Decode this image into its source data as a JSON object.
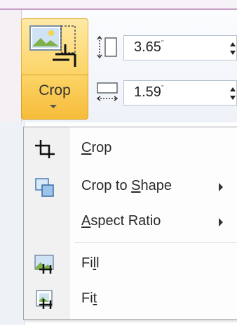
{
  "ribbon": {
    "crop_button": {
      "label": "Crop"
    },
    "height_field": {
      "value": "3.65",
      "unit": "\""
    },
    "width_field": {
      "value": "1.59",
      "unit": "\""
    }
  },
  "menu": {
    "items": [
      {
        "label_pre": "",
        "mnemonic": "C",
        "label_post": "rop",
        "icon": "crop-icon",
        "submenu": false
      },
      {
        "label_pre": "Crop to ",
        "mnemonic": "S",
        "label_post": "hape",
        "icon": "crop-to-shape-icon",
        "submenu": true
      },
      {
        "label_pre": "",
        "mnemonic": "A",
        "label_post": "spect Ratio",
        "icon": "",
        "submenu": true
      },
      {
        "label_pre": "Fi",
        "mnemonic": "l",
        "label_post": "l",
        "icon": "fill-icon",
        "submenu": false
      },
      {
        "label_pre": "Fi",
        "mnemonic": "t",
        "label_post": "",
        "icon": "fit-icon",
        "submenu": false
      }
    ]
  }
}
